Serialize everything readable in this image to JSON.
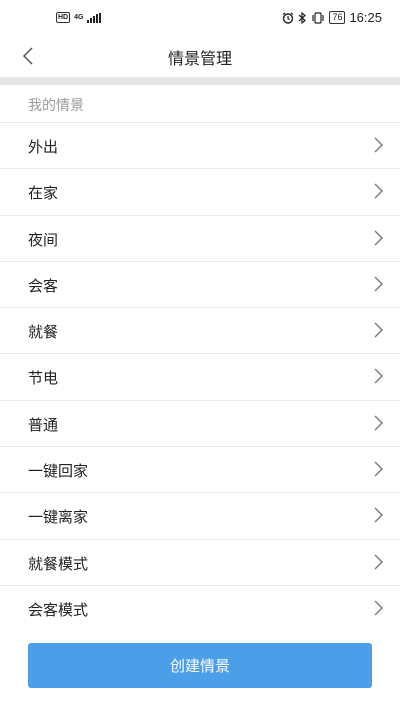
{
  "status_bar": {
    "hd_label": "HD",
    "network_label": "4G",
    "battery": "76",
    "time": "16:25",
    "icons": [
      "signal-icon",
      "alarm-icon",
      "bluetooth-icon",
      "vibrate-icon",
      "battery-icon"
    ]
  },
  "header": {
    "title": "情景管理",
    "back_icon": "chevron-left-icon"
  },
  "section": {
    "label": "我的情景"
  },
  "scenes": [
    {
      "label": "外出"
    },
    {
      "label": "在家"
    },
    {
      "label": "夜间"
    },
    {
      "label": "会客"
    },
    {
      "label": "就餐"
    },
    {
      "label": "节电"
    },
    {
      "label": "普通"
    },
    {
      "label": "一键回家"
    },
    {
      "label": "一键离家"
    },
    {
      "label": "就餐模式"
    },
    {
      "label": "会客模式"
    }
  ],
  "footer": {
    "create_label": "创建情景"
  },
  "colors": {
    "accent": "#4a9fe8",
    "divider": "#e6e6e6",
    "muted_text": "#9a9a9a"
  }
}
